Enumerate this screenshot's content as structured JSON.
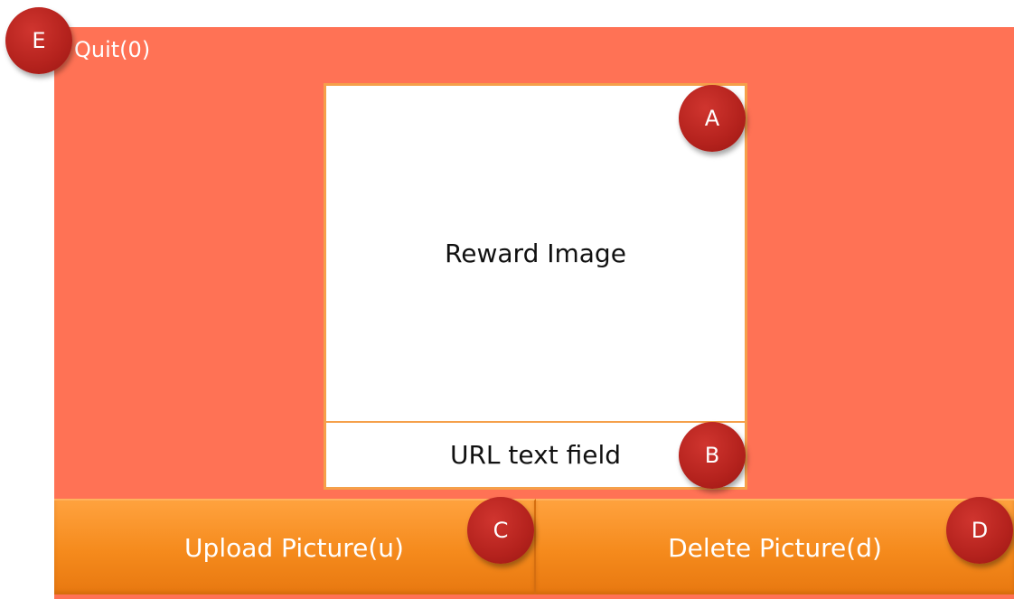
{
  "quit": {
    "label": "Quit(0)"
  },
  "image_area": {
    "label": "Reward Image"
  },
  "url_field": {
    "label": "URL text field"
  },
  "buttons": {
    "upload": "Upload Picture(u)",
    "delete": "Delete Picture(d)"
  },
  "badges": {
    "a": "A",
    "b": "B",
    "c": "C",
    "d": "D",
    "e": "E"
  },
  "colors": {
    "background_panel": "#ff7255",
    "button_orange": "#f58a1c",
    "border_orange": "#f5a04a",
    "badge_red": "#b4221d"
  }
}
